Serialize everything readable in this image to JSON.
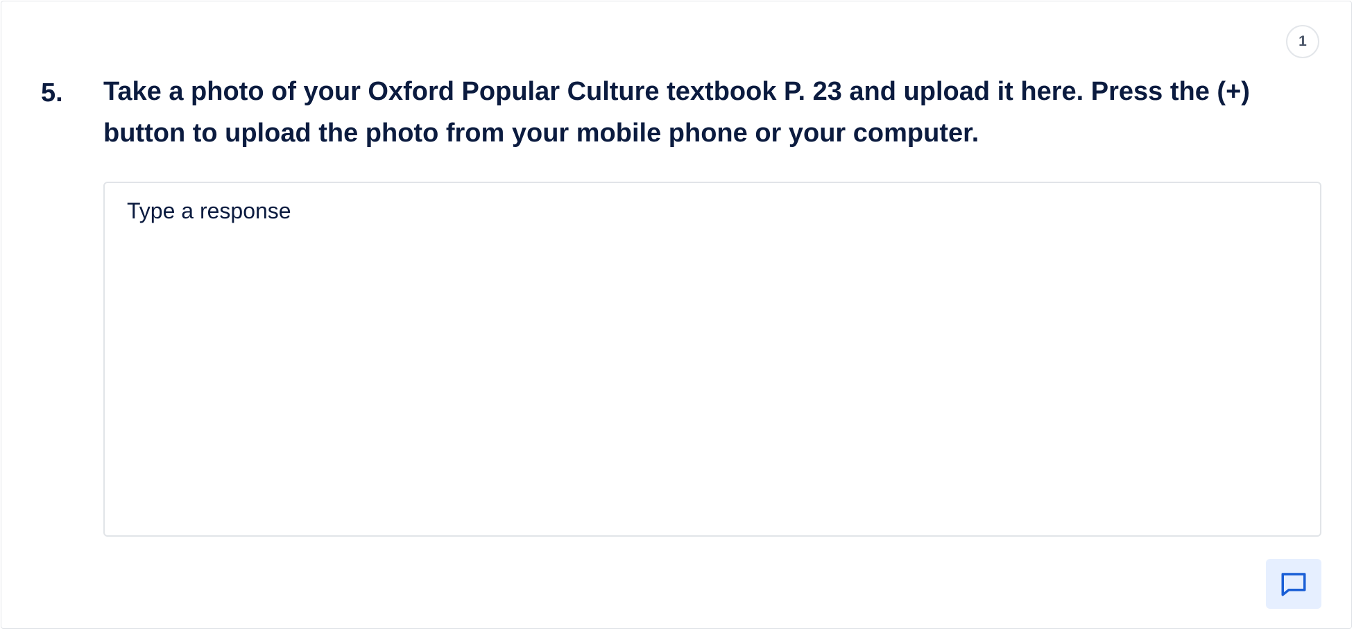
{
  "question": {
    "points": "1",
    "number": "5.",
    "text": "Take a photo of your Oxford Popular Culture textbook P. 23 and upload it here. Press the (+) button to upload the photo from your mobile phone or your computer."
  },
  "response": {
    "placeholder": "Type a response",
    "value": ""
  },
  "comment_button": {
    "icon": "comment-icon"
  },
  "colors": {
    "text": "#0b1b3f",
    "accent": "#1a5fd6",
    "accent_bg": "#e6efff",
    "border": "#e1e4e8"
  }
}
